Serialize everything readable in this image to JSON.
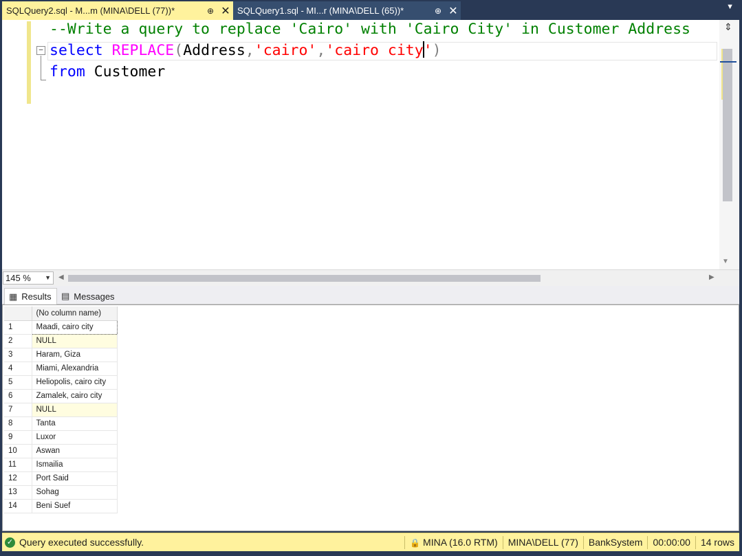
{
  "tabs": [
    {
      "title": "SQLQuery2.sql - M...m (MINA\\DELL (77))*",
      "pin": "⊕",
      "close": "✕"
    },
    {
      "title": "SQLQuery1.sql - MI...r (MINA\\DELL (65))*",
      "pin": "⊕",
      "close": "✕"
    }
  ],
  "overflow_icon": "▼",
  "editor": {
    "comment": "--Write a query to replace 'Cairo' with 'Cairo City' in Customer Address",
    "line2": {
      "kw_select": "select",
      "fn_replace": "REPLACE",
      "open_paren": "(",
      "arg1": "Address",
      "comma1": ",",
      "str1": "'cairo'",
      "comma2": ",",
      "str2_before_caret": "'cairo city",
      "str2_after_caret": "'",
      "close_paren": ")"
    },
    "line3": {
      "kw_from": "from",
      "table": "Customer"
    },
    "collapse_symbol": "−"
  },
  "zoom": {
    "value": "145 %",
    "dropdown": "▼"
  },
  "result_tabs": {
    "results": "Results",
    "messages": "Messages"
  },
  "grid": {
    "column_header": "(No column name)",
    "rows": [
      {
        "num": "1",
        "value": "Maadi, cairo city",
        "is_null": false
      },
      {
        "num": "2",
        "value": "NULL",
        "is_null": true
      },
      {
        "num": "3",
        "value": "Haram, Giza",
        "is_null": false
      },
      {
        "num": "4",
        "value": "Miami, Alexandria",
        "is_null": false
      },
      {
        "num": "5",
        "value": "Heliopolis, cairo city",
        "is_null": false
      },
      {
        "num": "6",
        "value": "Zamalek, cairo city",
        "is_null": false
      },
      {
        "num": "7",
        "value": "NULL",
        "is_null": true
      },
      {
        "num": "8",
        "value": "Tanta",
        "is_null": false
      },
      {
        "num": "9",
        "value": "Luxor",
        "is_null": false
      },
      {
        "num": "10",
        "value": "Aswan",
        "is_null": false
      },
      {
        "num": "11",
        "value": "Ismailia",
        "is_null": false
      },
      {
        "num": "12",
        "value": "Port Said",
        "is_null": false
      },
      {
        "num": "13",
        "value": "Sohag",
        "is_null": false
      },
      {
        "num": "14",
        "value": "Beni Suef",
        "is_null": false
      }
    ]
  },
  "status": {
    "message": "Query executed successfully.",
    "server": "MINA (16.0 RTM)",
    "user": "MINA\\DELL (77)",
    "database": "BankSystem",
    "elapsed": "00:00:00",
    "rows": "14 rows"
  },
  "colors": {
    "accent_yellow": "#fff29d",
    "chrome_blue": "#293955",
    "keyword": "#0000ff",
    "function": "#ff00ff",
    "string": "#ff0000",
    "comment": "#008000"
  }
}
